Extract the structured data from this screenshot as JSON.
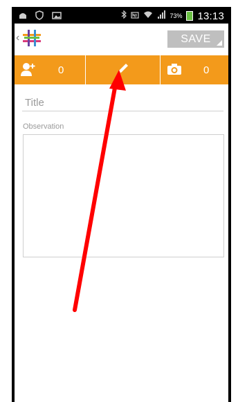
{
  "status_bar": {
    "time": "13:13",
    "battery_percent": "73%",
    "icons": [
      "android-debug-icon",
      "shield-icon",
      "picture-icon",
      "bluetooth-icon",
      "nfc-icon",
      "wifi-icon",
      "signal-icon",
      "battery-icon"
    ]
  },
  "action_bar": {
    "save_label": "SAVE",
    "logo_icon": "grid-hash-logo",
    "back_icon": "chevron-left-icon"
  },
  "tabs": {
    "people_count": "0",
    "photo_count": "0",
    "people_icon": "add-person-icon",
    "edit_icon": "pencil-icon",
    "photo_icon": "camera-icon"
  },
  "form": {
    "title_placeholder": "Title",
    "title_value": "",
    "observation_label": "Observation",
    "observation_value": ""
  },
  "colors": {
    "accent": "#f39a1b",
    "save_bg": "#bfbfbf",
    "annotation_arrow": "#ff0000"
  }
}
